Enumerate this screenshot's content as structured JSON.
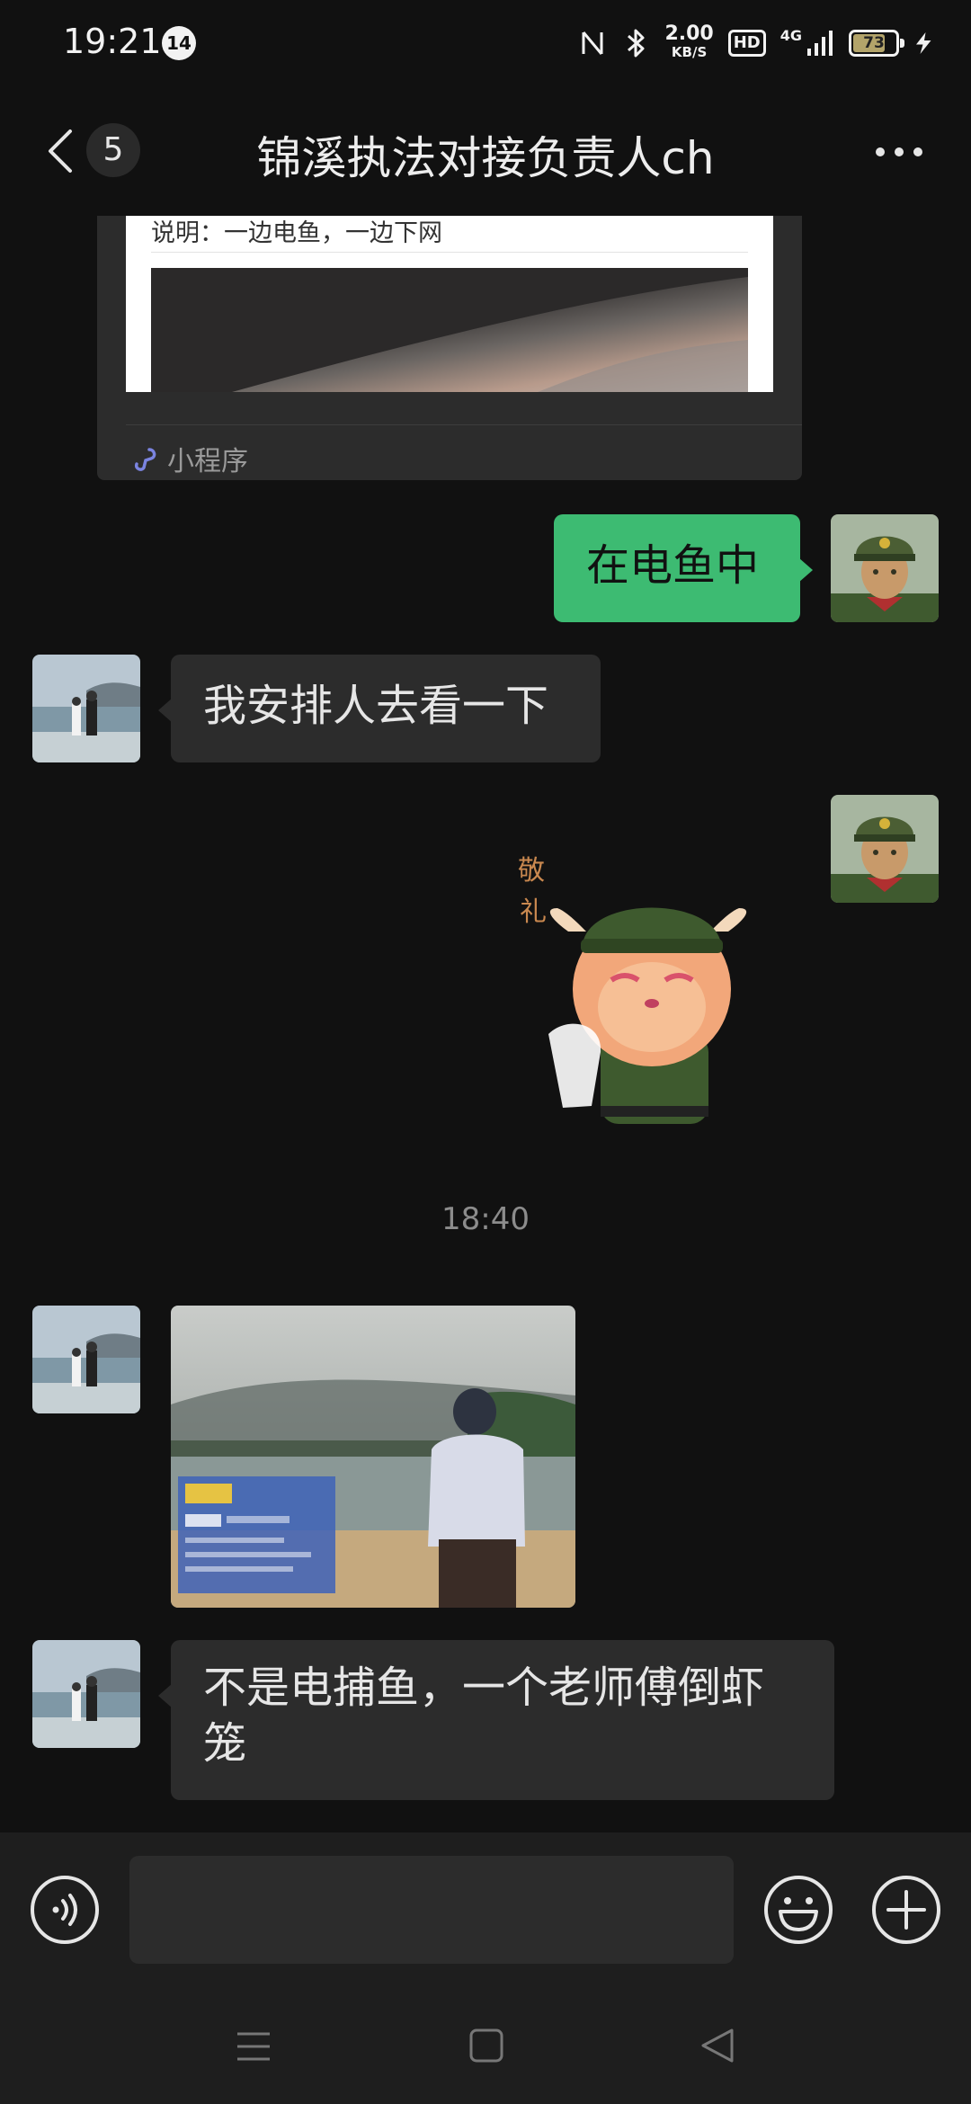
{
  "status_bar": {
    "time": "19:21",
    "notification_count": "14",
    "net_speed": "2.00",
    "net_unit": "KB/S",
    "hd": "HD",
    "network": "4G",
    "battery": "73"
  },
  "header": {
    "unread_count": "5",
    "title": "锦溪执法对接负责人ch"
  },
  "mini_program": {
    "description": "说明：一边电鱼，一边下网",
    "footer_label": "小程序"
  },
  "messages": [
    {
      "side": "me",
      "type": "text",
      "text": "在电鱼中"
    },
    {
      "side": "other",
      "type": "text",
      "text": "我安排人去看一下"
    },
    {
      "side": "me",
      "type": "sticker",
      "sticker_caption": "敬礼"
    },
    {
      "type": "timestamp",
      "text": "18:40"
    },
    {
      "side": "other",
      "type": "image"
    },
    {
      "side": "other",
      "type": "text",
      "text_line1": "不是电捕鱼，一个老师傅倒虾",
      "text_line2": "笼"
    }
  ],
  "colors": {
    "background": "#111111",
    "bubble_me": "#3dbb72",
    "bubble_other": "#2c2c2c",
    "input_bar": "#1e1e1e"
  },
  "icons": [
    "back-icon",
    "more-icon",
    "link-icon",
    "voice-icon",
    "emoji-icon",
    "plus-icon",
    "nav-menu-icon",
    "nav-home-icon",
    "nav-back-icon"
  ]
}
